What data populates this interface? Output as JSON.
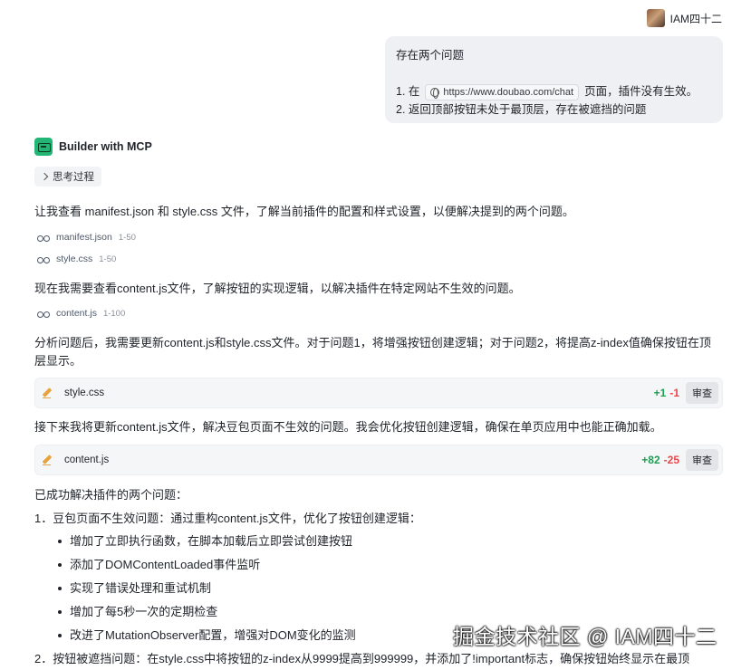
{
  "user": {
    "name": "IAM四十二"
  },
  "user_message": {
    "line1": "存在两个问题",
    "line2_prefix": "1. 在",
    "link": "https://www.doubao.com/chat",
    "line2_suffix": "页面，插件没有生效。",
    "line3": "2. 返回顶部按钮未处于最顶层，存在被遮挡的问题"
  },
  "bot": {
    "name": "Builder with MCP",
    "thinking_label": "思考过程"
  },
  "messages": {
    "p1": "让我查看 manifest.json 和 style.css 文件，了解当前插件的配置和样式设置，以便解决提到的两个问题。",
    "p2": "现在我需要查看content.js文件，了解按钮的实现逻辑，以解决插件在特定网站不生效的问题。",
    "p3": "分析问题后，我需要更新content.js和style.css文件。对于问题1，将增强按钮创建逻辑；对于问题2，将提高z-index值确保按钮在顶层显示。",
    "p4": "接下来我将更新content.js文件，解决豆包页面不生效的问题。我会优化按钮创建逻辑，确保在单页应用中也能正确加载。",
    "p5": "已成功解决插件的两个问题："
  },
  "file_refs": [
    {
      "name": "manifest.json",
      "range": "1-50"
    },
    {
      "name": "style.css",
      "range": "1-50"
    },
    {
      "name": "content.js",
      "range": "1-100"
    }
  ],
  "edits": [
    {
      "file": "style.css",
      "added": "+1",
      "removed": "-1",
      "review": "审查"
    },
    {
      "file": "content.js",
      "added": "+82",
      "removed": "-25",
      "review": "审查"
    }
  ],
  "summary": {
    "item1": "1．豆包页面不生效问题：通过重构content.js文件，优化了按钮创建逻辑：",
    "bullets": [
      "增加了立即执行函数，在脚本加载后立即尝试创建按钮",
      "添加了DOMContentLoaded事件监听",
      "实现了错误处理和重试机制",
      "增加了每5秒一次的定期检查",
      "改进了MutationObserver配置，增强对DOM变化的监测"
    ],
    "item2": "2．按钮被遮挡问题：在style.css中将按钮的z-index从9999提高到999999，并添加了!important标志，确保按钮始终显示在最顶"
  },
  "watermark": "掘金技术社区 @ IAM四十二"
}
